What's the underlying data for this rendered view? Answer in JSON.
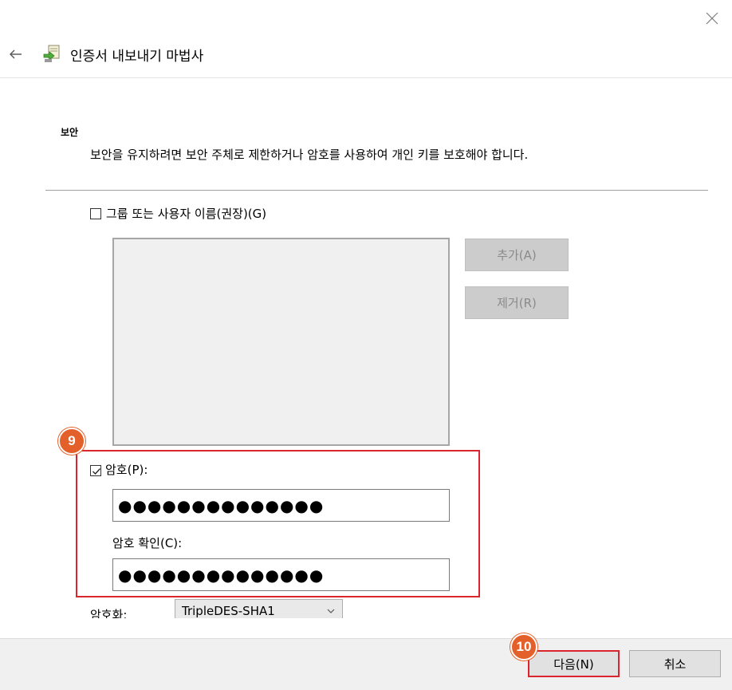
{
  "window": {
    "title": "인증서 내보내기 마법사"
  },
  "section": {
    "title": "보안",
    "description": "보안을 유지하려면 보안 주체로 제한하거나 암호를 사용하여 개인 키를 보호해야 합니다."
  },
  "group_user": {
    "label": "그룹 또는 사용자 이름(권장)(G)",
    "checked": false,
    "add_label": "추가(A)",
    "remove_label": "제거(R)"
  },
  "password": {
    "label": "암호(P):",
    "checked": true,
    "value": "●●●●●●●●●●●●●●",
    "confirm_label": "암호 확인(C):",
    "confirm_value": "●●●●●●●●●●●●●●"
  },
  "encryption": {
    "label": "암호화:",
    "selected": "TripleDES-SHA1"
  },
  "footer": {
    "next_label": "다음(N)",
    "cancel_label": "취소"
  },
  "annotations": {
    "step_a": "9",
    "step_b": "10"
  },
  "colors": {
    "highlight": "#d9262c",
    "badge": "#e4602a"
  }
}
